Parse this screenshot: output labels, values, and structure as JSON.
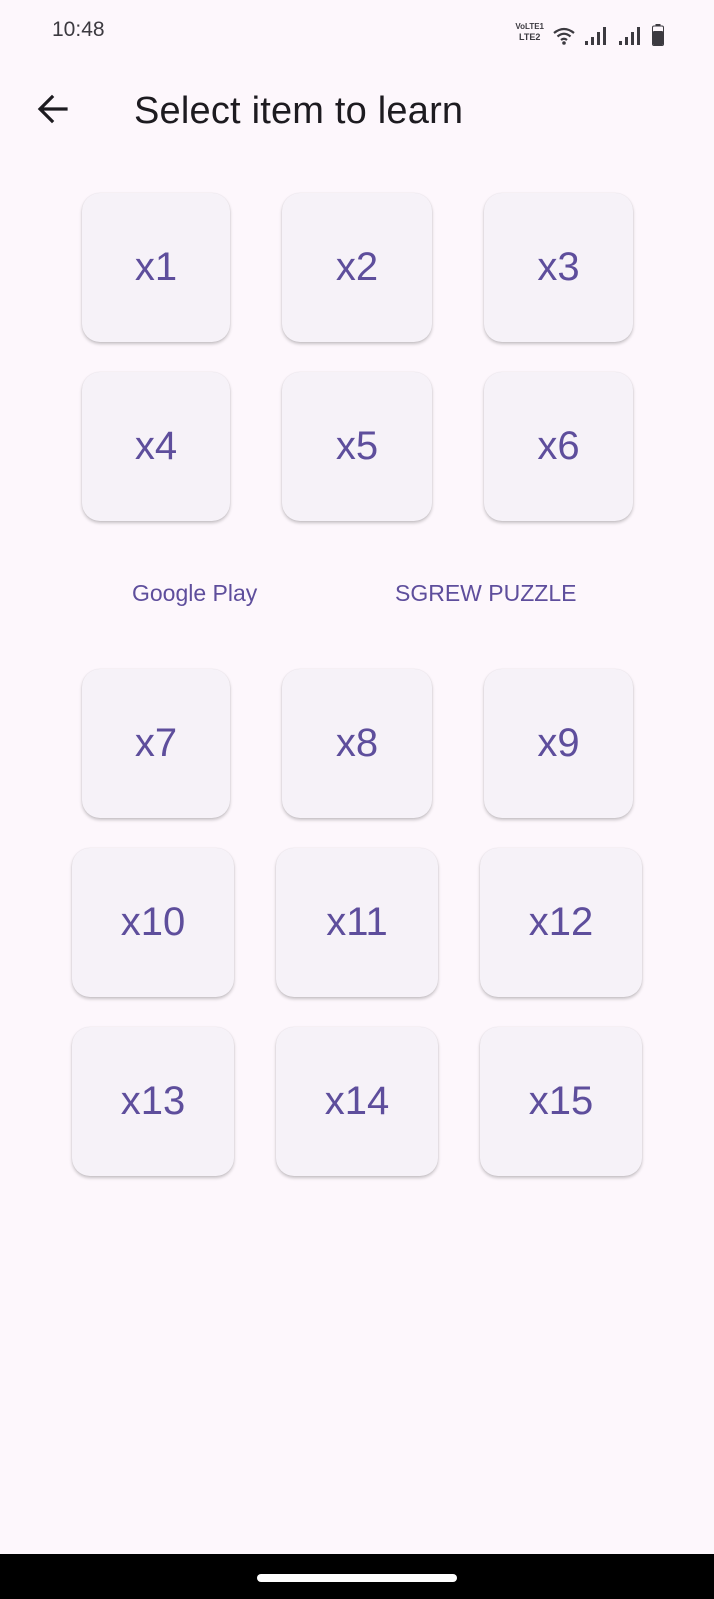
{
  "status_bar": {
    "time": "10:48",
    "network_label_top": "VoLTE1",
    "network_label_bottom": "LTE2"
  },
  "header": {
    "title": "Select item to learn",
    "back_icon": "arrow-left-icon"
  },
  "tiles_group_1": [
    {
      "label": "x1"
    },
    {
      "label": "x2"
    },
    {
      "label": "x3"
    },
    {
      "label": "x4"
    },
    {
      "label": "x5"
    },
    {
      "label": "x6"
    }
  ],
  "links": {
    "google_play": "Google Play",
    "sgrew_puzzle": "SGREW PUZZLE"
  },
  "tiles_group_2": [
    {
      "label": "x7"
    },
    {
      "label": "x8"
    },
    {
      "label": "x9"
    }
  ],
  "tiles_group_3": [
    {
      "label": "x10"
    },
    {
      "label": "x11"
    },
    {
      "label": "x12"
    },
    {
      "label": "x13"
    },
    {
      "label": "x14"
    },
    {
      "label": "x15"
    }
  ],
  "colors": {
    "background": "#fdf7fc",
    "tile_background": "#f6f2f8",
    "accent_text": "#5e4e9c",
    "title_text": "#1d1b20"
  }
}
